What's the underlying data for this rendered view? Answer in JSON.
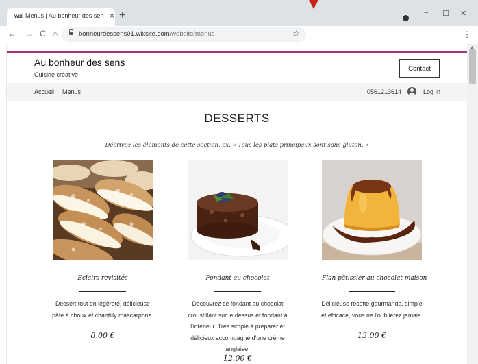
{
  "browser": {
    "tab_title": "Menus | Au bonheur des sens",
    "tab_favicon_text": "wix",
    "tab_close": "×",
    "new_tab": "+",
    "url_domain": "bonheurdessens01.wixsite.com",
    "url_path": "/website/menus",
    "back": "←",
    "forward": "→",
    "reload": "C",
    "home": "⌂",
    "star": "☆",
    "menu": "⋮",
    "minimize": "−",
    "maximize": "☐",
    "close": "✕"
  },
  "site": {
    "name": "Au bonheur des sens",
    "tagline": "Cuisine créative",
    "contact_label": "Contact"
  },
  "nav": {
    "items": [
      "Accueil",
      "Menus"
    ],
    "phone": "0561213614",
    "login": "Log In"
  },
  "section": {
    "title": "DESSERTS",
    "description": "Décrivez les éléments de cette section, ex. « Tous les plats principaux sont sans gluten. »"
  },
  "dishes": [
    {
      "name": "Eclairs revisités",
      "description": [
        "Dessert tout en légèreté, délicieuse",
        "pâte à choux et chantilly mascarpone."
      ],
      "price": "8.00 €",
      "image": "eclairs-photo"
    },
    {
      "name": "Fondant au chocolat",
      "description": [
        "Découvrez ce fondant au chocolat",
        "croustillant sur le dessus et fondant à",
        "l'intérieur. Très simple à préparer et",
        "délicieux accompagné d'une crème",
        "anglaise."
      ],
      "price": "12.00 €",
      "image": "fondant-photo"
    },
    {
      "name": "Flan pâtissier au chocolat maison",
      "description": [
        "Délicieuse recette gourmande, simple",
        "et efficace, vous ne l'oublierez jamais."
      ],
      "price": "13.00 €",
      "image": "flan-photo"
    }
  ],
  "colors": {
    "accent_line": "#a8317a",
    "marker": "#cc1f1a"
  }
}
